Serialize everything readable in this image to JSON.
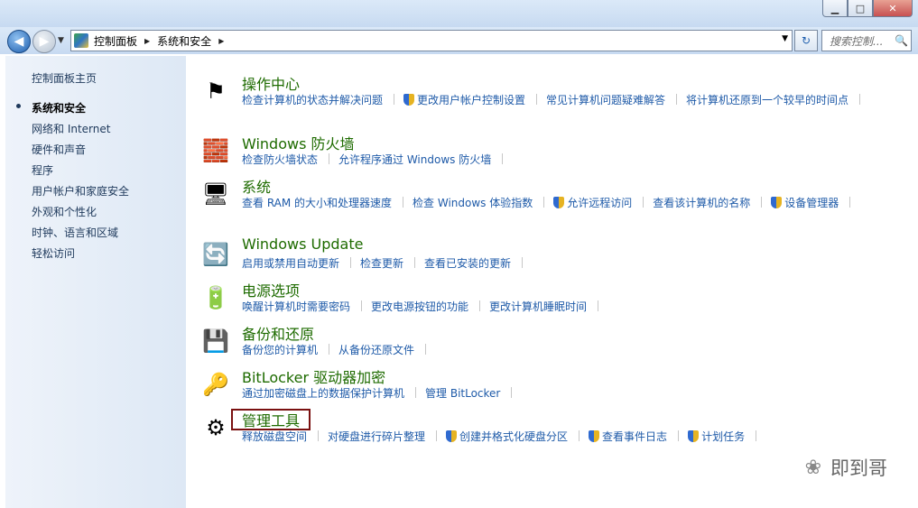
{
  "window": {
    "min_label": "▁",
    "max_label": "□",
    "close_label": "✕"
  },
  "nav": {
    "back_icon": "◀",
    "forward_icon": "▶",
    "dropdown_icon": "▼",
    "breadcrumbs": [
      "控制面板",
      "系统和安全"
    ],
    "separator": "▶",
    "search_placeholder": "搜索控制...",
    "search_icon": "🔍",
    "refresh_icon": "↻"
  },
  "sidebar": {
    "items": [
      {
        "label": "控制面板主页"
      },
      {
        "label": "系统和安全"
      },
      {
        "label": "网络和 Internet"
      },
      {
        "label": "硬件和声音"
      },
      {
        "label": "程序"
      },
      {
        "label": "用户帐户和家庭安全"
      },
      {
        "label": "外观和个性化"
      },
      {
        "label": "时钟、语言和区域"
      },
      {
        "label": "轻松访问"
      }
    ]
  },
  "categories": [
    {
      "title": "操作中心",
      "icon": "⚑",
      "links": [
        {
          "label": "检查计算机的状态并解决问题",
          "shield": false
        },
        {
          "label": "更改用户帐户控制设置",
          "shield": true
        },
        {
          "label": "常见计算机问题疑难解答",
          "shield": false
        },
        {
          "label": "将计算机还原到一个较早的时间点",
          "shield": false
        }
      ]
    },
    {
      "title": "Windows 防火墙",
      "icon": "🧱",
      "links": [
        {
          "label": "检查防火墙状态",
          "shield": false
        },
        {
          "label": "允许程序通过 Windows 防火墙",
          "shield": false
        }
      ]
    },
    {
      "title": "系统",
      "icon": "🖥",
      "links": [
        {
          "label": "查看 RAM 的大小和处理器速度",
          "shield": false
        },
        {
          "label": "检查 Windows 体验指数",
          "shield": false
        },
        {
          "label": "允许远程访问",
          "shield": true
        },
        {
          "label": "查看该计算机的名称",
          "shield": false
        },
        {
          "label": "设备管理器",
          "shield": true
        }
      ]
    },
    {
      "title": "Windows Update",
      "icon": "🔄",
      "links": [
        {
          "label": "启用或禁用自动更新",
          "shield": false
        },
        {
          "label": "检查更新",
          "shield": false
        },
        {
          "label": "查看已安装的更新",
          "shield": false
        }
      ]
    },
    {
      "title": "电源选项",
      "icon": "🔋",
      "links": [
        {
          "label": "唤醒计算机时需要密码",
          "shield": false
        },
        {
          "label": "更改电源按钮的功能",
          "shield": false
        },
        {
          "label": "更改计算机睡眠时间",
          "shield": false
        }
      ]
    },
    {
      "title": "备份和还原",
      "icon": "💾",
      "links": [
        {
          "label": "备份您的计算机",
          "shield": false
        },
        {
          "label": "从备份还原文件",
          "shield": false
        }
      ]
    },
    {
      "title": "BitLocker 驱动器加密",
      "icon": "🔑",
      "links": [
        {
          "label": "通过加密磁盘上的数据保护计算机",
          "shield": false
        },
        {
          "label": "管理 BitLocker",
          "shield": false
        }
      ]
    },
    {
      "title": "管理工具",
      "icon": "⚙",
      "links": [
        {
          "label": "释放磁盘空间",
          "shield": false
        },
        {
          "label": "对硬盘进行碎片整理",
          "shield": false
        },
        {
          "label": "创建并格式化硬盘分区",
          "shield": true
        },
        {
          "label": "查看事件日志",
          "shield": true
        },
        {
          "label": "计划任务",
          "shield": true
        }
      ]
    }
  ],
  "watermark": {
    "icon": "❀",
    "text": "即到哥"
  }
}
